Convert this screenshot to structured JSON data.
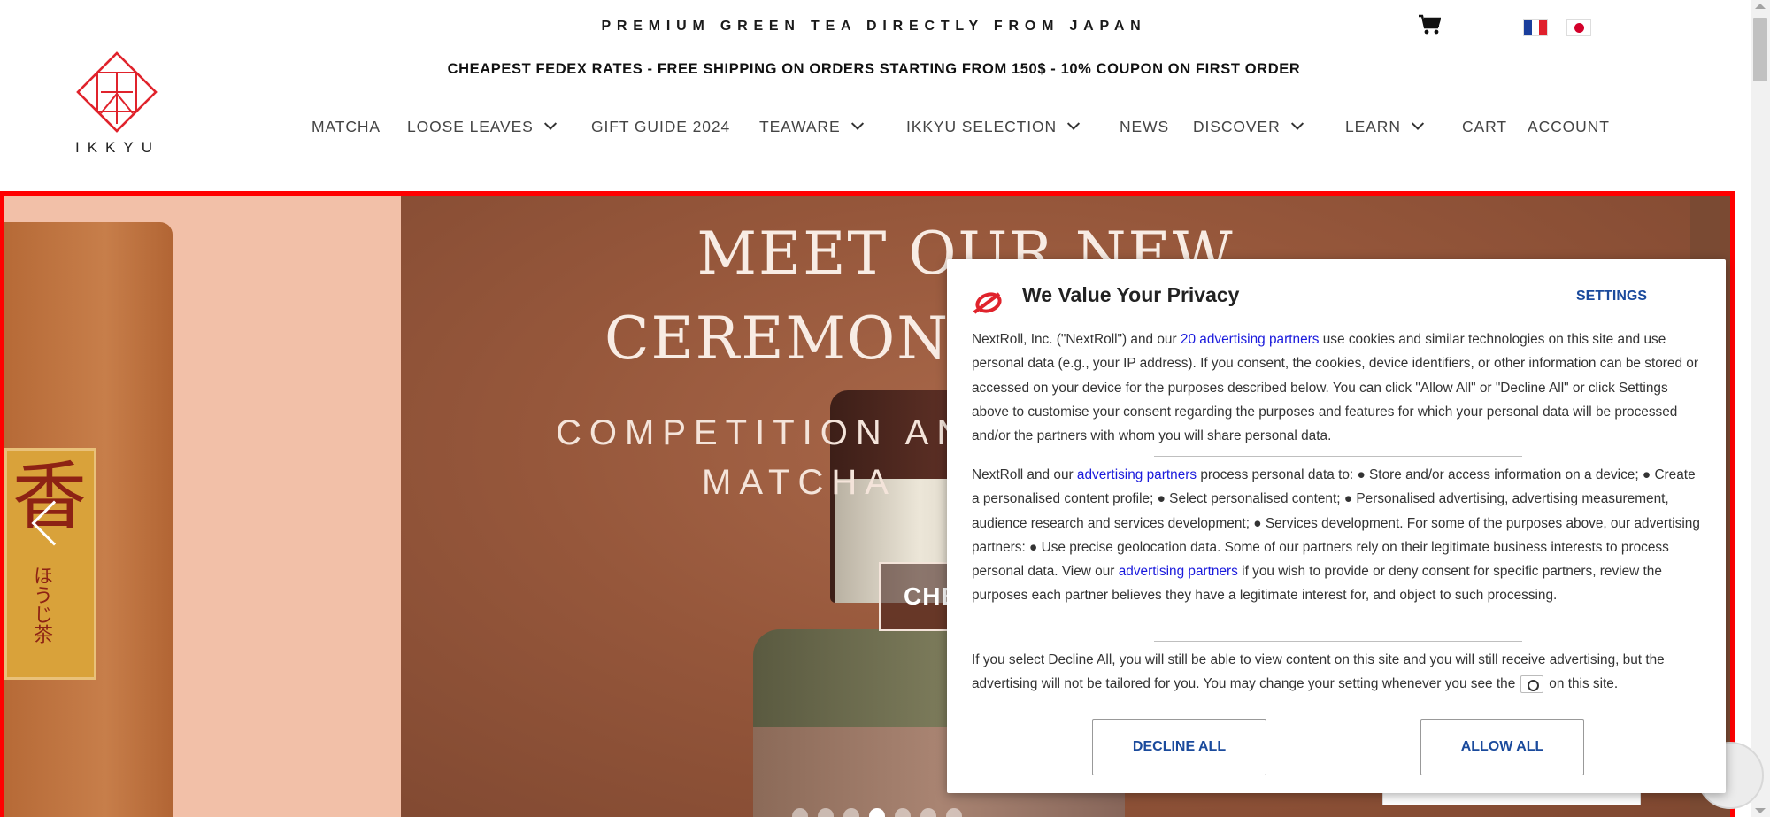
{
  "header": {
    "tagline": "PREMIUM GREEN TEA DIRECTLY FROM JAPAN",
    "promo": "CHEAPEST FEDEX RATES - FREE SHIPPING ON ORDERS STARTING FROM 150$ - 10% COUPON ON FIRST ORDER",
    "logo_text": "IKKYU",
    "icons": {
      "cart": "cart-icon",
      "lang_fr": "flag-france-icon",
      "lang_jp": "flag-japan-icon"
    }
  },
  "nav": {
    "items": [
      {
        "label": "MATCHA",
        "has_dropdown": false
      },
      {
        "label": "LOOSE LEAVES",
        "has_dropdown": true
      },
      {
        "label": "GIFT GUIDE 2024",
        "has_dropdown": false
      },
      {
        "label": "TEAWARE",
        "has_dropdown": true
      },
      {
        "label": "IKKYU SELECTION",
        "has_dropdown": true
      },
      {
        "label": "NEWS",
        "has_dropdown": false
      },
      {
        "label": "DISCOVER",
        "has_dropdown": true
      },
      {
        "label": "LEARN",
        "has_dropdown": true
      },
      {
        "label": "CART",
        "has_dropdown": false
      },
      {
        "label": "ACCOUNT",
        "has_dropdown": false
      }
    ]
  },
  "hero": {
    "title_line1": "MEET OUR NEW",
    "title_line2": "CEREMONI",
    "subtitle_line1": "COMPETITION AN",
    "subtitle_line2": "MATCHA",
    "cta": "CHE",
    "left_product_kanji": "香",
    "left_product_sub": "ほうじ茶",
    "dots_count": 7,
    "active_dot": 4
  },
  "consent": {
    "title": "We Value Your Privacy",
    "settings": "SETTINGS",
    "p1_before": "NextRoll, Inc. (\"NextRoll\") and our ",
    "p1_link": "20 advertising partners",
    "p1_after": " use cookies and similar technologies on this site and use personal data (e.g., your IP address). If you consent, the cookies, device identifiers, or other information can be stored or accessed on your device for the purposes described below. You can click \"Allow All\" or \"Decline All\" or click Settings above to customise your consent regarding the purposes and features for which your personal data will be processed and/or the partners with whom you will share personal data.",
    "p2_before": "NextRoll and our ",
    "p2_link": "advertising partners",
    "p2_middle": " process personal data to: ● Store and/or access information on a device; ● Create a personalised content profile; ● Select personalised content; ● Personalised advertising, advertising measurement, audience research and services development; ● Services development. For some of the purposes above, our advertising partners: ● Use precise geolocation data. Some of our partners rely on their legitimate business interests to process personal data. View our ",
    "p2_link2": "advertising partners",
    "p2_after": " if you wish to provide or deny consent for specific partners, review the purposes each partner believes they have a legitimate interest for, and object to such processing.",
    "p3_before": "If you select Decline All, you will still be able to view content on this site and you will still receive advertising, but the advertising will not be tailored for you. You may change your setting whenever you see the",
    "p3_after": "on this site.",
    "decline": "DECLINE ALL",
    "allow": "ALLOW ALL",
    "icons": {
      "brand": "nextroll-logo-icon",
      "inline": "privacy-settings-icon"
    }
  },
  "colors": {
    "accent_red": "#e0232c",
    "link_blue": "#1a1adc",
    "button_blue": "#1a4a9c",
    "hero_border": "#ff0000"
  }
}
